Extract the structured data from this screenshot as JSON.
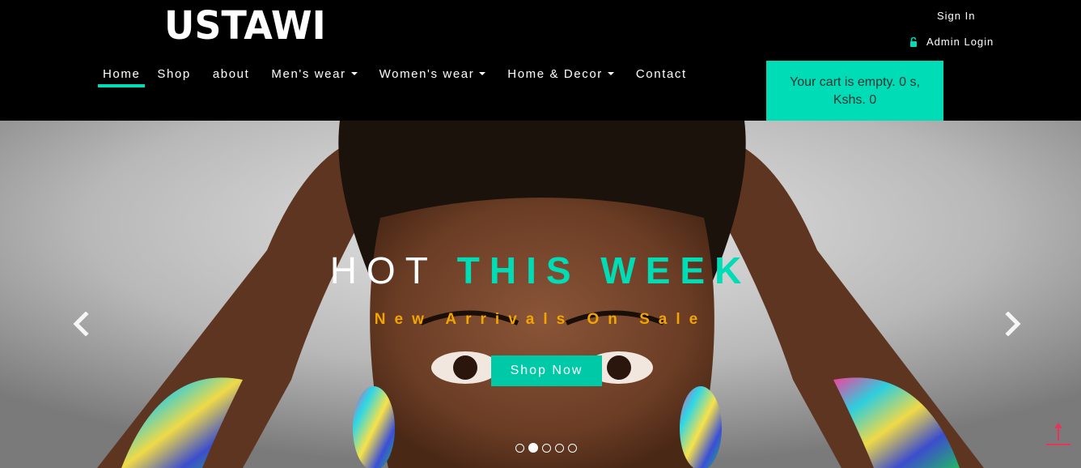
{
  "brand": {
    "logo_text": "USTAWI"
  },
  "account": {
    "signin_label": "Sign In",
    "admin_label": "Admin Login"
  },
  "nav": {
    "items": [
      {
        "label": "Home",
        "active": true,
        "dropdown": false
      },
      {
        "label": "Shop",
        "active": false,
        "dropdown": false
      },
      {
        "label": "about",
        "active": false,
        "dropdown": false
      },
      {
        "label": "Men's wear",
        "active": false,
        "dropdown": true
      },
      {
        "label": "Women's wear",
        "active": false,
        "dropdown": true
      },
      {
        "label": "Home & Decor",
        "active": false,
        "dropdown": true
      },
      {
        "label": "Contact",
        "active": false,
        "dropdown": false
      }
    ]
  },
  "cart": {
    "line1": "Your cart is empty. 0 s,",
    "line2": "Kshs. 0"
  },
  "hero": {
    "headline_plain": "HOT",
    "headline_accent": "THIS WEEK",
    "subhead": "New Arrivals On Sale",
    "cta_label": "Shop Now",
    "slide_count": 5,
    "active_slide": 2
  },
  "icons": {
    "lock": "lock-open-icon",
    "prev": "chevron-left-icon",
    "next": "chevron-right-icon",
    "scroll_top": "arrow-up-icon"
  },
  "colors": {
    "accent": "#00dcb6",
    "subhead": "#f2a500",
    "header_bg": "#000000"
  }
}
